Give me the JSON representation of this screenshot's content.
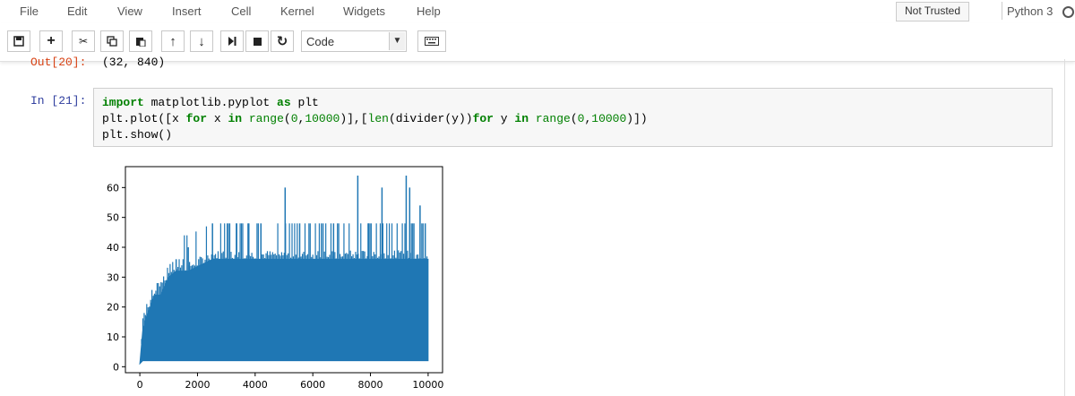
{
  "menu": {
    "items": [
      "File",
      "Edit",
      "View",
      "Insert",
      "Cell",
      "Kernel",
      "Widgets",
      "Help"
    ],
    "trusted_label": "Not Trusted",
    "kernel_name": "Python 3"
  },
  "toolbar": {
    "buttons": [
      {
        "name": "save-button",
        "icon": "floppy-icon",
        "glyph": "💾"
      },
      {
        "name": "insert-cell-button",
        "icon": "plus-icon",
        "glyph": "+"
      },
      {
        "name": "cut-button",
        "icon": "scissors-icon",
        "glyph": "✂"
      },
      {
        "name": "copy-button",
        "icon": "copy-icon",
        "glyph": "⧉"
      },
      {
        "name": "paste-button",
        "icon": "paste-icon",
        "glyph": "📋"
      },
      {
        "name": "move-up-button",
        "icon": "arrow-up-icon",
        "glyph": "↑"
      },
      {
        "name": "move-down-button",
        "icon": "arrow-down-icon",
        "glyph": "↓"
      },
      {
        "name": "run-button",
        "icon": "step-forward-icon",
        "glyph": "⏭"
      },
      {
        "name": "interrupt-button",
        "icon": "stop-icon",
        "glyph": "■"
      },
      {
        "name": "restart-button",
        "icon": "refresh-icon",
        "glyph": "↻"
      }
    ],
    "cell_type": "Code",
    "keyboard_icon": "keyboard-icon"
  },
  "cells": {
    "out20": {
      "prompt": "Out[20]:",
      "text": "(32, 840)"
    },
    "in21": {
      "prompt": "In [21]:",
      "lines": [
        "import matplotlib.pyplot as plt",
        "plt.plot([x for x in range(0,10000)],[len(divider(y))for y in range(0,10000)])",
        "plt.show()"
      ]
    }
  },
  "chart_data": {
    "type": "line",
    "title": "",
    "xlabel": "",
    "ylabel": "",
    "xlim": [
      -500,
      10500
    ],
    "ylim": [
      -2,
      67
    ],
    "x_ticks": [
      0,
      2000,
      4000,
      6000,
      8000,
      10000
    ],
    "y_ticks": [
      0,
      10,
      20,
      30,
      40,
      50,
      60
    ],
    "grid": false,
    "series": [
      {
        "color": "#1f77b4",
        "envelope_x": [
          0,
          100,
          200,
          360,
          500,
          720,
          1000,
          1260,
          1680,
          2520,
          3000,
          3600,
          4000,
          5000,
          6000,
          7000,
          7560,
          8000,
          9000,
          9240,
          9700,
          9999
        ],
        "envelope_max": [
          1,
          12,
          16,
          20,
          24,
          24,
          30,
          32,
          32,
          36,
          36,
          36,
          36,
          36,
          36,
          36,
          36,
          36,
          36,
          36,
          36,
          36
        ],
        "envelope_min": [
          1,
          2,
          2,
          2,
          2,
          2,
          2,
          2,
          2,
          2,
          2,
          2,
          2,
          2,
          2,
          2,
          2,
          2,
          2,
          2,
          2,
          2
        ],
        "peaks_x": [
          1260,
          1680,
          2520,
          3360,
          3780,
          4200,
          5040,
          5544,
          6300,
          6720,
          7560,
          7920,
          8400,
          9240,
          9360,
          9720,
          9900
        ],
        "peaks_y": [
          36,
          40,
          48,
          48,
          48,
          48,
          60,
          48,
          48,
          48,
          64,
          48,
          60,
          64,
          60,
          54,
          48
        ]
      }
    ]
  }
}
